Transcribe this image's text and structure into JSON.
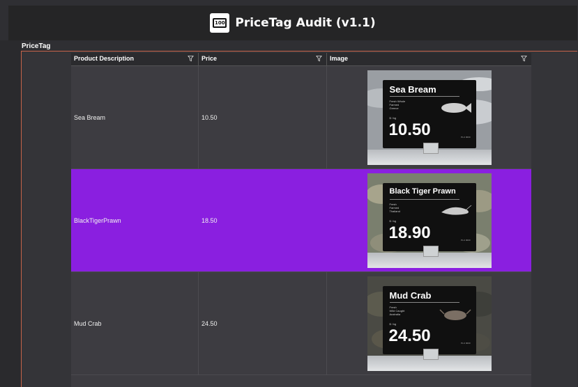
{
  "app": {
    "title": "PriceTag Audit (v1.1)",
    "logo_text": "100"
  },
  "section": {
    "label": "PriceTag"
  },
  "grid": {
    "columns": [
      {
        "label": "Product Description",
        "icon": "filter-icon"
      },
      {
        "label": "Price",
        "icon": "filter-icon"
      },
      {
        "label": "Image",
        "icon": "filter-icon"
      }
    ],
    "rows": [
      {
        "description": "Sea Bream",
        "price": "10.50",
        "image": {
          "name": "Sea Bream",
          "details": "Fresh Whole\nFarmed\nGreece",
          "per": "$ / kg",
          "price": "10.50",
          "plu": "PLU 0000"
        },
        "selected": false
      },
      {
        "description": "BlackTigerPrawn",
        "price": "18.50",
        "image": {
          "name": "Black Tiger Prawn",
          "details": "Fresh\nFarmed\nThailand",
          "per": "$ / kg",
          "price": "18.90",
          "plu": "PLU 0000"
        },
        "selected": true
      },
      {
        "description": "Mud Crab",
        "price": "24.50",
        "image": {
          "name": "Mud Crab",
          "details": "Fresh\nWild Caught\nAustralia",
          "per": "$ / kg",
          "price": "24.50",
          "plu": "PLU 0000"
        },
        "selected": false
      }
    ]
  },
  "colors": {
    "accent": "#8a1fe0",
    "frame_border": "#c8644a",
    "title_bar": "#252526"
  }
}
